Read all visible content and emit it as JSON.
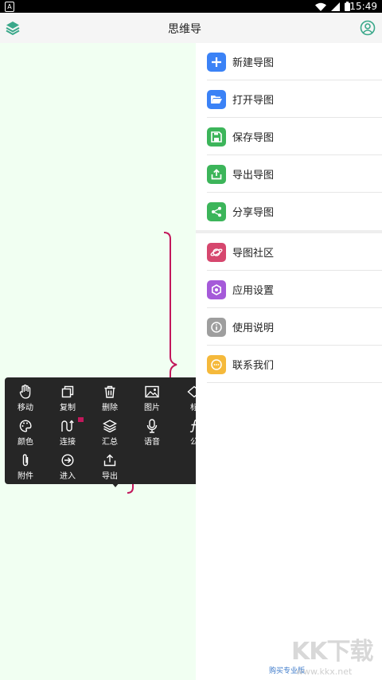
{
  "status_bar": {
    "notification_glyph": "A",
    "time": "15:49"
  },
  "app_bar": {
    "title": "思维导"
  },
  "drawer": {
    "items": [
      {
        "label": "新建导图",
        "icon": "plus-icon",
        "color": "#3b82f6"
      },
      {
        "label": "打开导图",
        "icon": "folder-open-icon",
        "color": "#3b82f6"
      },
      {
        "label": "保存导图",
        "icon": "save-icon",
        "color": "#3cb55a"
      },
      {
        "label": "导出导图",
        "icon": "export-icon",
        "color": "#3cb55a"
      },
      {
        "label": "分享导图",
        "icon": "share-icon",
        "color": "#3cb55a"
      },
      {
        "label": "导图社区",
        "icon": "planet-icon",
        "color": "#d6476e"
      },
      {
        "label": "应用设置",
        "icon": "settings-icon",
        "color": "#a55ad9"
      },
      {
        "label": "使用说明",
        "icon": "info-icon",
        "color": "#9e9e9e"
      },
      {
        "label": "联系我们",
        "icon": "chat-icon",
        "color": "#f5b93b"
      }
    ],
    "buy_label": "购买专业版"
  },
  "toolbar": {
    "tools": [
      {
        "label": "移动",
        "icon": "hand-icon"
      },
      {
        "label": "复制",
        "icon": "copy-icon"
      },
      {
        "label": "删除",
        "icon": "trash-icon"
      },
      {
        "label": "图片",
        "icon": "image-icon"
      },
      {
        "label": "标",
        "icon": "tag-icon"
      },
      {
        "label": "颜色",
        "icon": "palette-icon"
      },
      {
        "label": "连接",
        "icon": "connect-icon"
      },
      {
        "label": "汇总",
        "icon": "layers-icon"
      },
      {
        "label": "语音",
        "icon": "mic-icon"
      },
      {
        "label": "公",
        "icon": "formula-icon"
      },
      {
        "label": "附件",
        "icon": "paperclip-icon"
      },
      {
        "label": "进入",
        "icon": "enter-icon"
      },
      {
        "label": "导出",
        "icon": "upload-icon"
      }
    ]
  },
  "watermark": {
    "brand": "KK下载",
    "url": "www.kkx.net"
  },
  "colors": {
    "canvas_bg": "#f1fff2",
    "brace": "#c2185b",
    "accent": "#3aa88a"
  }
}
